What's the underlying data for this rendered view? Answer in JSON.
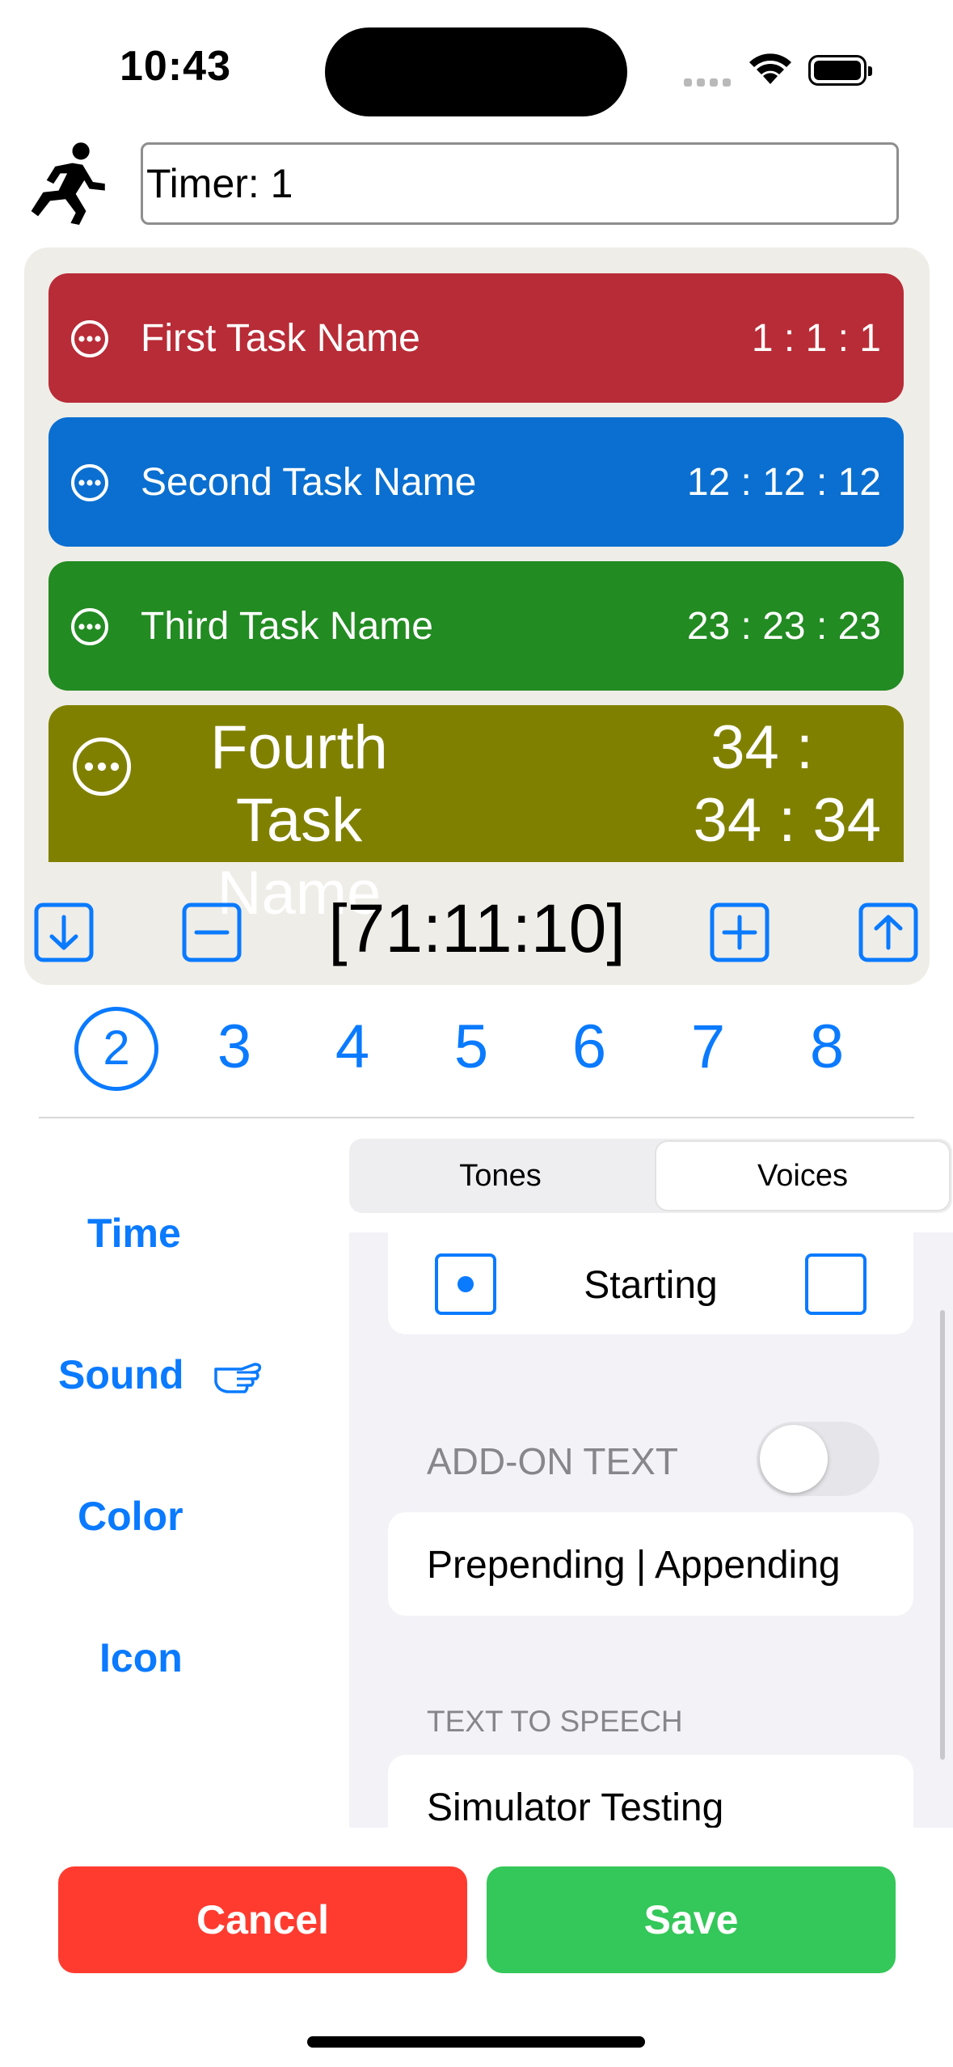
{
  "status_bar": {
    "time": "10:43"
  },
  "header": {
    "timer_name": "Timer: 1"
  },
  "tasks": [
    {
      "name": "First Task Name",
      "time": "1 : 1 : 1",
      "color": "#b82c37"
    },
    {
      "name": "Second Task Name",
      "time": "12 : 12 : 12",
      "color": "#0a6fd0"
    },
    {
      "name": "Third Task Name",
      "time": "23 : 23 : 23",
      "color": "#228b22"
    },
    {
      "name_line1": "Fourth",
      "name_line2": "Task Name",
      "time_line1": "34 :",
      "time_line2": "34 : 34",
      "color": "#808000"
    }
  ],
  "controls": {
    "total_time": "[71:11:10]"
  },
  "pages": {
    "selected": "2",
    "items": [
      "3",
      "4",
      "5",
      "6",
      "7",
      "8"
    ]
  },
  "sidebar": {
    "time": "Time",
    "sound": "Sound",
    "color": "Color",
    "icon": "Icon"
  },
  "segmented": {
    "tones": "Tones",
    "voices": "Voices",
    "selected": "Voices"
  },
  "settings": {
    "starting_label": "Starting",
    "addon_header": "ADD-ON TEXT",
    "addon_toggle_on": false,
    "prepend_append": "Prepending | Appending",
    "tts_header": "TEXT TO SPEECH",
    "tts_value": "Simulator Testing"
  },
  "buttons": {
    "cancel": "Cancel",
    "save": "Save",
    "cancel_color": "#ff3b30",
    "save_color": "#34c759"
  },
  "colors": {
    "accent": "#0a7aff",
    "panel_bg": "#efede7"
  }
}
